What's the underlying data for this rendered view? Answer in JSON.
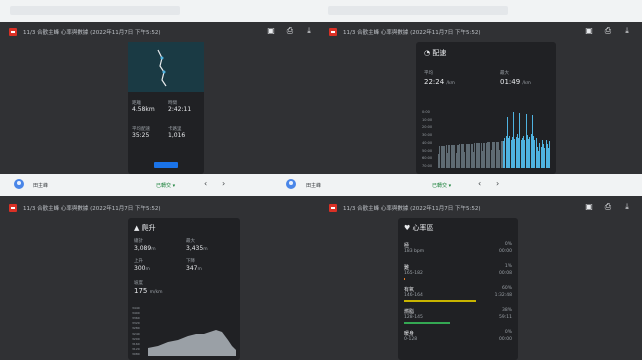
{
  "icons": {
    "pdf": "pdf-icon",
    "comment": "comment-icon",
    "print": "print-icon",
    "download": "download-icon",
    "more": "more-icon",
    "heart": "heart-icon",
    "mountain": "mountain-icon",
    "gauge": "speed-icon"
  },
  "colors": {
    "dark_bg": "#303134",
    "card_bg": "#202124",
    "accent_blue": "#4fb3e0",
    "zone_yellow": "#c8b400",
    "zone_green": "#34a853"
  },
  "pane1": {
    "title": "11/3 合歡主峰 心率與數據 (2022年11月7日 下午5:52)",
    "stats": [
      {
        "label": "距離",
        "value": "4.58km"
      },
      {
        "label": "時間",
        "value": "2:42:11"
      },
      {
        "label": "平均配速",
        "value": "35:25"
      },
      {
        "label": "卡路里",
        "value": "1,016"
      }
    ],
    "footer": {
      "name": "田主峰",
      "dropdown": "已轉交 ▾"
    }
  },
  "pane2": {
    "title": "11/3 合歡主峰 心率與數據 (2022年11月7日 下午5:52)",
    "section": "配速",
    "avg_label": "平均",
    "avg_value": "22:24",
    "avg_unit": "/km",
    "best_label": "最大",
    "best_value": "01:49",
    "best_unit": "/km",
    "y_ticks": [
      "0:00",
      "10:00",
      "20:00",
      "30:00",
      "40:00",
      "50:00",
      "60:00",
      "70:00"
    ],
    "footer": {
      "name": "田主峰",
      "dropdown": "已轉交 ▾"
    }
  },
  "pane3": {
    "title": "11/3 合歡主峰 心率與數據 (2022年11月7日 下午5:52)",
    "section": "爬升",
    "rows": [
      {
        "l1": "總計",
        "v1": "3,089",
        "u1": "m",
        "l2": "最大",
        "v2": "3,435",
        "u2": "m"
      },
      {
        "l1": "上升",
        "v1": "300",
        "u1": "m",
        "l2": "下降",
        "v2": "347",
        "u2": "m"
      }
    ],
    "grade_label": "坡度",
    "grade_value": "175",
    "grade_unit": "m/km",
    "y_ticks": [
      "3440",
      "3400",
      "3360",
      "3320",
      "3280",
      "3240",
      "3200",
      "3160",
      "3120",
      "3080"
    ]
  },
  "pane4": {
    "title": "11/3 合歡主峰 心率與數據 (2022年11月7日 下午5:52)",
    "section": "心率區",
    "zones": [
      {
        "name": "極",
        "range": "183 bpm",
        "pct": "0%",
        "time": "00:00",
        "color": "#c0392b",
        "frac": 0
      },
      {
        "name": "難",
        "range": "165-182",
        "pct": "1%",
        "time": "00:08",
        "color": "#e67e22",
        "frac": 0.01
      },
      {
        "name": "有氧",
        "range": "146-164",
        "pct": "60%",
        "time": "1:32:48",
        "color": "#c8b400",
        "frac": 0.6
      },
      {
        "name": "燃脂",
        "range": "128-145",
        "pct": "38%",
        "time": "59:11",
        "color": "#34a853",
        "frac": 0.38
      },
      {
        "name": "暖身",
        "range": "0-128",
        "pct": "0%",
        "time": "00:00",
        "color": "#4fb3e0",
        "frac": 0
      }
    ]
  }
}
